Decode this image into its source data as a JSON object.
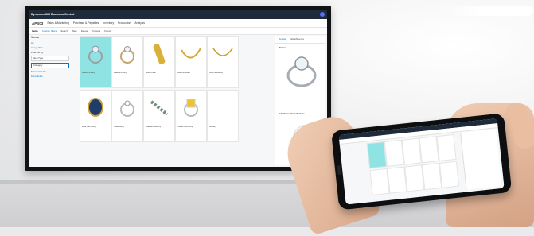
{
  "app": {
    "title": "Dynamics 365 Business Central",
    "company": "APS03",
    "menu": [
      "Sales & Marketing",
      "Purchase & Payables",
      "Inventory",
      "Production",
      "Analysis"
    ],
    "actions": [
      "Items",
      "Custom filters",
      "Search",
      "New",
      "Delete",
      "Process",
      "Filters"
    ]
  },
  "views": {
    "heading": "Views",
    "items": [
      "All",
      "Image filter",
      "Filter list by",
      "Item Type",
      "Category",
      "Filter totals by",
      "More fields"
    ]
  },
  "items": [
    {
      "name": "Diamond Ring",
      "selected": true
    },
    {
      "name": "Diamond Ring",
      "selected": false
    },
    {
      "name": "Gold Chain",
      "selected": false
    },
    {
      "name": "Gold Bracelet",
      "selected": false
    },
    {
      "name": "Gold Necklace",
      "selected": false
    },
    {
      "name": "Blue Gem Ring",
      "selected": false
    },
    {
      "name": "Silver Ring",
      "selected": false
    },
    {
      "name": "Bracelet Jewelry",
      "selected": false
    },
    {
      "name": "Yellow Gem Ring",
      "selected": false
    },
    {
      "name": "Jewelry",
      "selected": false
    }
  ],
  "details": {
    "tabs": [
      "Details",
      "Attachments"
    ],
    "picture_label": "Picture",
    "additional_label": "Additional Item Picture"
  },
  "colors": {
    "topbar": "#1d2b3a",
    "selected_tile": "#8fe3e3",
    "accent": "#0078d4"
  }
}
